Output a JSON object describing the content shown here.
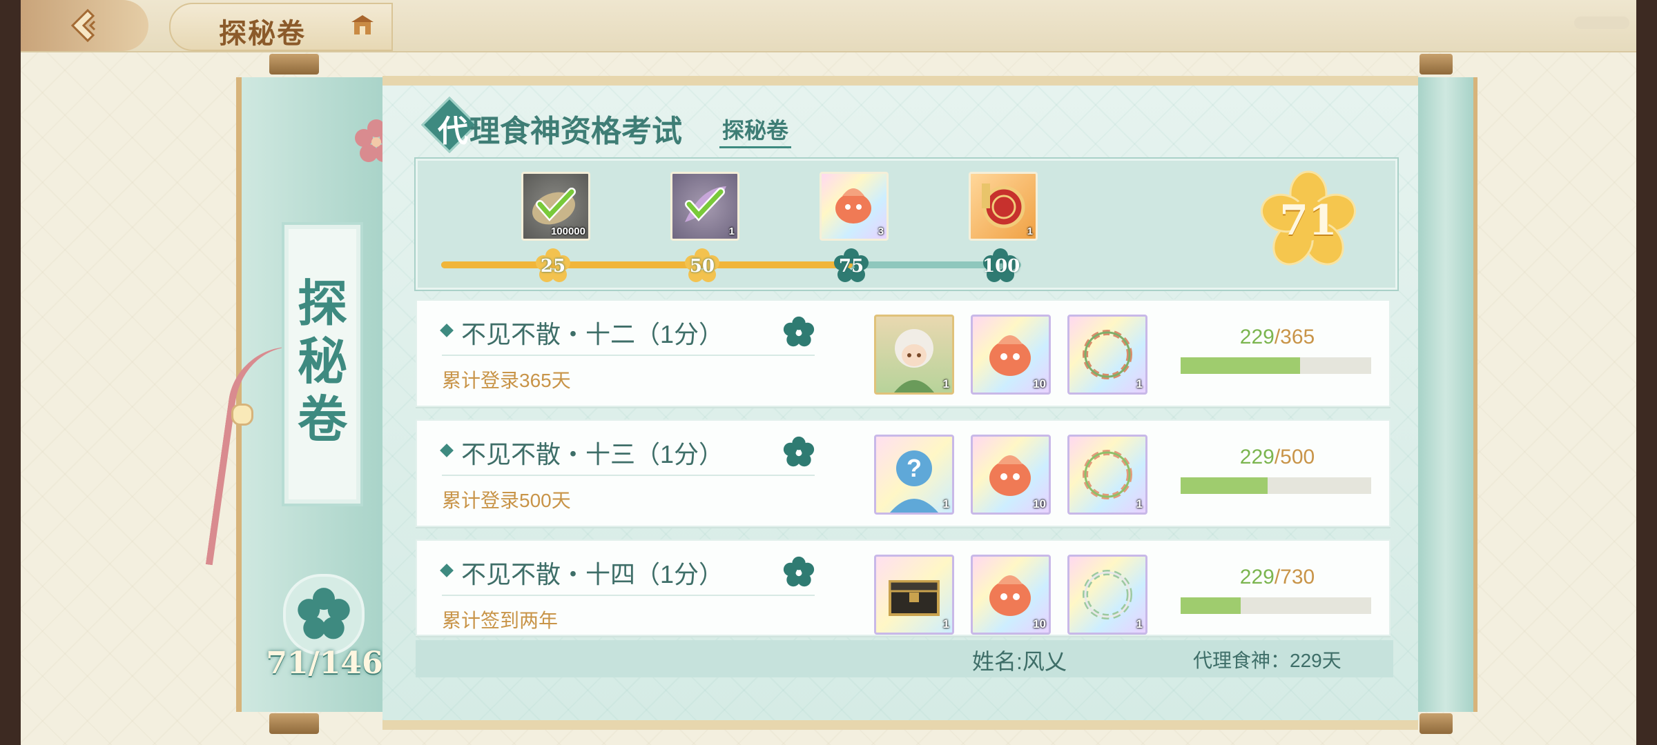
{
  "header": {
    "title": "探秘卷"
  },
  "sidebar": {
    "vertical_label": [
      "探",
      "秘",
      "卷"
    ],
    "count": "71/146"
  },
  "main": {
    "title_first": "代",
    "title_rest": "理食神资格考试",
    "subtab": "探秘卷"
  },
  "milestones": {
    "score": "71",
    "progress_fraction": 0.71,
    "nodes": [
      {
        "label": "25",
        "reward_count": "100000",
        "claimed": true,
        "icon": "leaf-coin-icon"
      },
      {
        "label": "50",
        "reward_count": "1",
        "claimed": true,
        "icon": "feather-icon"
      },
      {
        "label": "75",
        "reward_count": "3",
        "claimed": false,
        "icon": "fire-spirit-icon"
      },
      {
        "label": "100",
        "reward_count": "1",
        "claimed": false,
        "icon": "seal-badge-icon"
      }
    ]
  },
  "quests": [
    {
      "title": "不见不散・十二（1分）",
      "desc": "累计登录365天",
      "current": "229",
      "total": "/365",
      "progress_fraction": 0.627,
      "rewards": [
        {
          "icon": "character-portrait-icon",
          "count": "1"
        },
        {
          "icon": "fire-spirit-icon",
          "count": "10"
        },
        {
          "icon": "wreath-frame-icon",
          "count": "1"
        }
      ]
    },
    {
      "title": "不见不散・十三（1分）",
      "desc": "累计登录500天",
      "current": "229",
      "total": "/500",
      "progress_fraction": 0.458,
      "rewards": [
        {
          "icon": "mystery-character-icon",
          "count": "1"
        },
        {
          "icon": "fire-spirit-icon",
          "count": "10"
        },
        {
          "icon": "wreath-frame-icon",
          "count": "1"
        }
      ]
    },
    {
      "title": "不见不散・十四（1分）",
      "desc": "累计签到两年",
      "current": "229",
      "total": "/730",
      "progress_fraction": 0.314,
      "rewards": [
        {
          "icon": "treasure-chest-icon",
          "count": "1"
        },
        {
          "icon": "fire-spirit-icon",
          "count": "10"
        },
        {
          "icon": "wreath-frame-icon",
          "count": "1"
        }
      ]
    }
  ],
  "footer": {
    "name": "姓名:风乂",
    "agent_days": "代理食神：229天"
  },
  "colors": {
    "teal": "#3e8a80",
    "gold": "#f1b53a",
    "green_progress": "#9fcc6e",
    "tan_text": "#c89448"
  }
}
